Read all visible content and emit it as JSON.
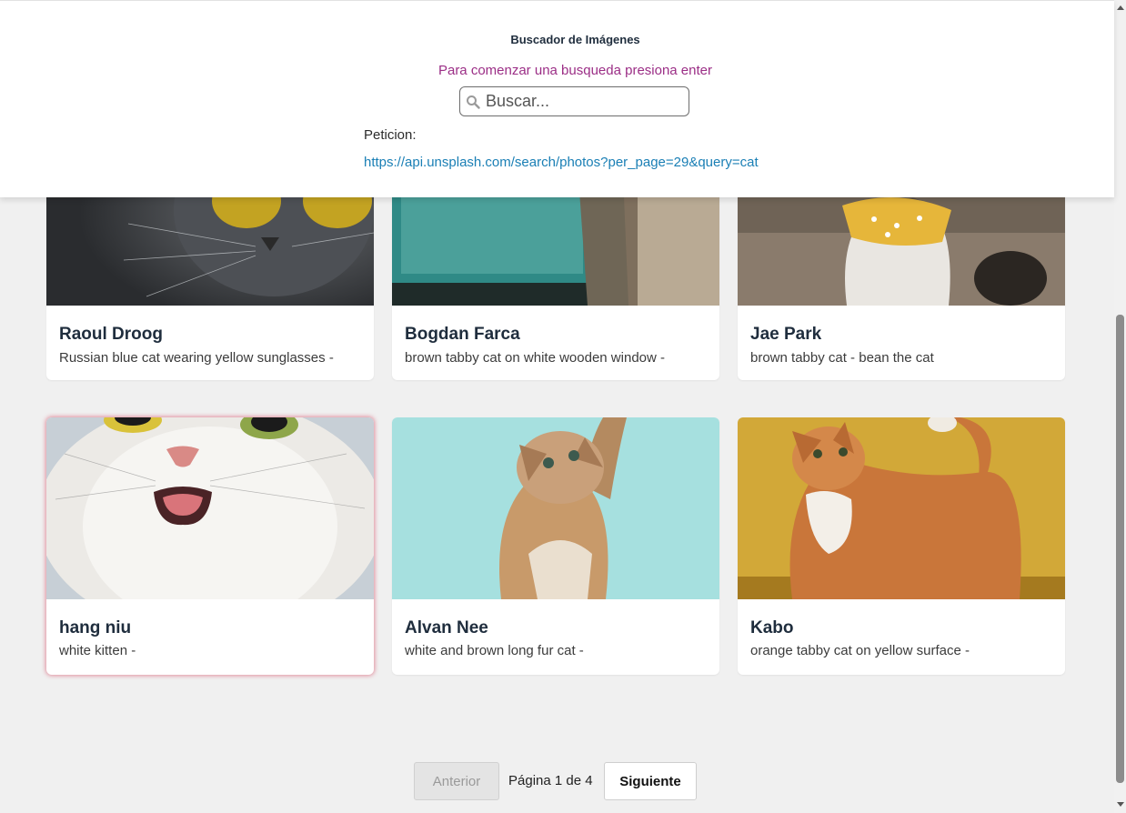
{
  "header": {
    "title": "Buscador de Imágenes",
    "hint": "Para comenzar una busqueda presiona enter",
    "search_placeholder": "Buscar...",
    "request_label": "Peticion:",
    "request_url": "https://api.unsplash.com/search/photos?per_page=29&query=cat"
  },
  "cards": [
    {
      "author": "Raoul Droog",
      "description": "Russian blue cat wearing yellow sunglasses -",
      "image": "grey cat with yellow sunglasses"
    },
    {
      "author": "Bogdan Farca",
      "description": "brown tabby cat on white wooden window -",
      "image": "tabby cat at window"
    },
    {
      "author": "Jae Park",
      "description": "brown tabby cat - bean the cat",
      "image": "cat with yellow bandana"
    },
    {
      "author": "hang niu",
      "description": "white kitten -",
      "image": "white kitten face"
    },
    {
      "author": "Alvan Nee",
      "description": "white and brown long fur cat -",
      "image": "kitten on teal background"
    },
    {
      "author": "Kabo",
      "description": "orange tabby cat on yellow surface -",
      "image": "orange cat on mustard background"
    }
  ],
  "pagination": {
    "prev_label": "Anterior",
    "page_info": "Página 1 de 4",
    "next_label": "Siguiente"
  },
  "colors": {
    "accent_hint": "#9b2e86",
    "link": "#1a7fb5",
    "page_bg": "#f0f0f0"
  },
  "icons": {
    "search": "search-icon"
  }
}
